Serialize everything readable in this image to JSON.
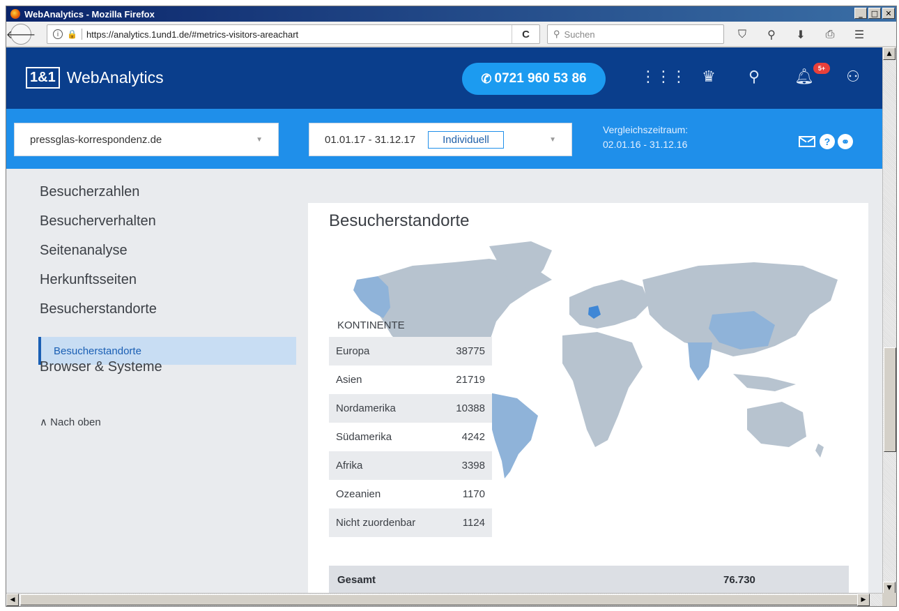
{
  "window": {
    "title": "WebAnalytics - Mozilla Firefox"
  },
  "browser": {
    "url": "https://analytics.1und1.de/#metrics-visitors-areachart",
    "search_placeholder": "Suchen"
  },
  "app": {
    "logo_box": "1&1",
    "logo_name": "WebAnalytics",
    "phone": "0721 960 53 86",
    "notification_badge": "5+"
  },
  "filter": {
    "domain": "pressglas-korrespondenz.de",
    "date_range": "01.01.17 - 31.12.17",
    "date_mode": "Individuell",
    "compare_label": "Vergleichszeitraum:",
    "compare_range": "02.01.16 - 31.12.16"
  },
  "sidebar": {
    "items": [
      {
        "label": "Besucherzahlen"
      },
      {
        "label": "Besucherverhalten"
      },
      {
        "label": "Seitenanalyse"
      },
      {
        "label": "Herkunftsseiten"
      },
      {
        "label": "Besucherstandorte"
      }
    ],
    "active_subitem": "Besucherstandorte",
    "after_item": "Browser & Systeme",
    "back_to_top": "Nach oben"
  },
  "main": {
    "title": "Besucherstandorte",
    "continents_header": "KONTINENTE",
    "continents": [
      {
        "name": "Europa",
        "value": "38775"
      },
      {
        "name": "Asien",
        "value": "21719"
      },
      {
        "name": "Nordamerika",
        "value": "10388"
      },
      {
        "name": "Südamerika",
        "value": "4242"
      },
      {
        "name": "Afrika",
        "value": "3398"
      },
      {
        "name": "Ozeanien",
        "value": "1170"
      },
      {
        "name": "Nicht zuordenbar",
        "value": "1124"
      }
    ],
    "total_label": "Gesamt",
    "total_value": "76.730"
  },
  "colors": {
    "header_bg": "#0a3e8c",
    "filter_bg": "#1f8fea",
    "phone_btn": "#1c9bf0",
    "map_land": "#b7c3cf",
    "map_highlight_high": "#3f87d6",
    "map_highlight_mid": "#8fb3d9"
  }
}
